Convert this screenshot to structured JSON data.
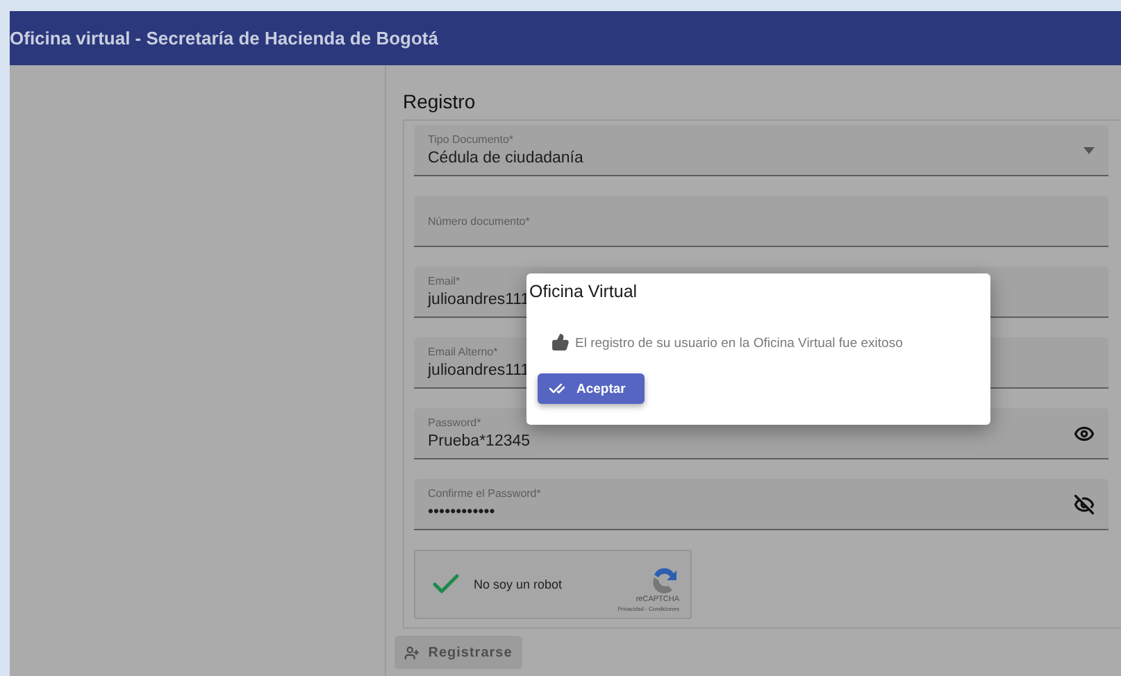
{
  "header": {
    "title": "Oficina virtual - Secretaría de Hacienda de Bogotá"
  },
  "form": {
    "title": "Registro",
    "fields": [
      {
        "kind": "select",
        "label": "Tipo Documento*",
        "value": "Cédula de ciudadanía"
      },
      {
        "kind": "text",
        "label": "Número documento*"
      },
      {
        "kind": "text",
        "label": "Email*",
        "value": "julioandres111"
      },
      {
        "kind": "text",
        "label": "Email Alterno*",
        "value": "julioandres111"
      },
      {
        "kind": "password",
        "label": "Password*",
        "value": "Prueba*12345",
        "revealed": true
      },
      {
        "kind": "password",
        "label": "Confirme el Password*",
        "value": "••••••••••••",
        "revealed": false
      }
    ],
    "captcha": {
      "label": "No soy un robot",
      "checked": true,
      "brand": "reCAPTCHA",
      "links": "Privacidad - Condiciones"
    },
    "submit": {
      "label": "Registrarse",
      "disabled": true
    }
  },
  "dialog": {
    "title": "Oficina Virtual",
    "message": "El registro de su usuario en la Oficina Virtual fue exitoso",
    "button": "Aceptar"
  }
}
